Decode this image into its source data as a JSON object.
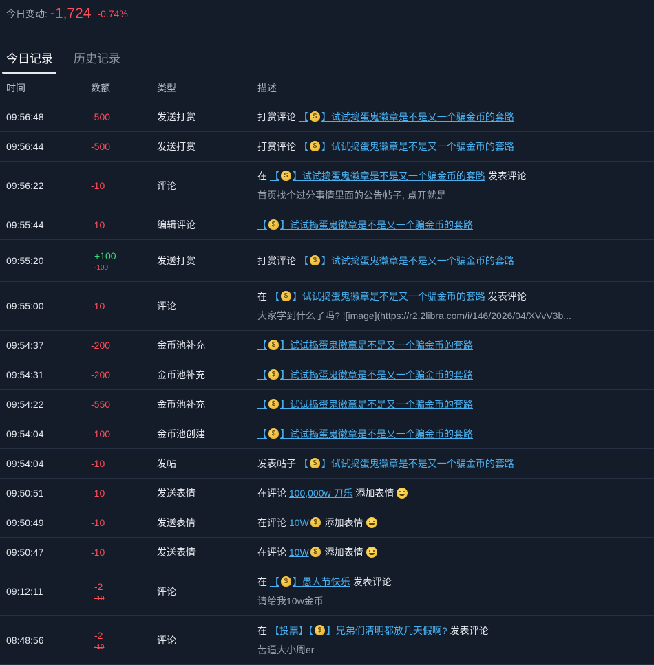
{
  "summary": {
    "label": "今日变动:",
    "value": "-1,724",
    "percent": "-0.74%"
  },
  "tabs": [
    {
      "label": "今日记录"
    },
    {
      "label": "历史记录"
    }
  ],
  "columns": {
    "time": "时间",
    "amount": "数额",
    "type": "类型",
    "desc": "描述"
  },
  "rows": [
    {
      "time": "09:56:48",
      "amount": "-500",
      "type": "发送打赏",
      "prefix": "打赏评论",
      "bracket_open": "【",
      "bracket_close": "】",
      "link": "试试捣蛋鬼徽章是不是又一个骗金币的套路"
    },
    {
      "time": "09:56:44",
      "amount": "-500",
      "type": "发送打赏",
      "prefix": "打赏评论",
      "bracket_open": "【",
      "bracket_close": "】",
      "link": "试试捣蛋鬼徽章是不是又一个骗金币的套路"
    },
    {
      "time": "09:56:22",
      "amount": "-10",
      "type": "评论",
      "prefix": "在",
      "bracket_open": "【",
      "bracket_close": "】",
      "link": "试试捣蛋鬼徽章是不是又一个骗金币的套路",
      "suffix": "发表评论",
      "sub": "首页找个过分事情里面的公告帖子, 点开就是"
    },
    {
      "time": "09:55:44",
      "amount": "-10",
      "type": "编辑评论",
      "bracket_open": "【",
      "bracket_close": "】",
      "link": "试试捣蛋鬼徽章是不是又一个骗金币的套路"
    },
    {
      "time": "09:55:20",
      "amount": "+100",
      "orig": "-100",
      "type": "发送打赏",
      "prefix": "打赏评论",
      "bracket_open": "【",
      "bracket_close": "】",
      "link": "试试捣蛋鬼徽章是不是又一个骗金币的套路"
    },
    {
      "time": "09:55:00",
      "amount": "-10",
      "type": "评论",
      "prefix": "在",
      "bracket_open": "【",
      "bracket_close": "】",
      "link": "试试捣蛋鬼徽章是不是又一个骗金币的套路",
      "suffix": "发表评论",
      "sub": "大家学到什么了吗? ![image](https://r2.2libra.com/i/146/2026/04/XVvV3b..."
    },
    {
      "time": "09:54:37",
      "amount": "-200",
      "type": "金币池补充",
      "bracket_open": "【",
      "bracket_close": "】",
      "link": "试试捣蛋鬼徽章是不是又一个骗金币的套路"
    },
    {
      "time": "09:54:31",
      "amount": "-200",
      "type": "金币池补充",
      "bracket_open": "【",
      "bracket_close": "】",
      "link": "试试捣蛋鬼徽章是不是又一个骗金币的套路"
    },
    {
      "time": "09:54:22",
      "amount": "-550",
      "type": "金币池补充",
      "bracket_open": "【",
      "bracket_close": "】",
      "link": "试试捣蛋鬼徽章是不是又一个骗金币的套路"
    },
    {
      "time": "09:54:04",
      "amount": "-100",
      "type": "金币池创建",
      "bracket_open": "【",
      "bracket_close": "】",
      "link": "试试捣蛋鬼徽章是不是又一个骗金币的套路"
    },
    {
      "time": "09:54:04",
      "amount": "-10",
      "type": "发帖",
      "prefix": "发表帖子",
      "bracket_open": "【",
      "bracket_close": "】",
      "link": "试试捣蛋鬼徽章是不是又一个骗金币的套路"
    },
    {
      "time": "09:50:51",
      "amount": "-10",
      "type": "发送表情",
      "prefix": "在评论",
      "link": "100,000w 刀乐",
      "suffix": "添加表情"
    },
    {
      "time": "09:50:49",
      "amount": "-10",
      "type": "发送表情",
      "prefix": "在评论",
      "link": "10W",
      "suffix": "添加表情"
    },
    {
      "time": "09:50:47",
      "amount": "-10",
      "type": "发送表情",
      "prefix": "在评论",
      "link": "10W",
      "suffix": "添加表情"
    },
    {
      "time": "09:12:11",
      "amount": "-2",
      "orig": "-10",
      "type": "评论",
      "prefix": "在",
      "bracket_open": "【",
      "bracket_close": "】",
      "link": "愚人节快乐",
      "suffix": "发表评论",
      "sub": "请给我10w金币"
    },
    {
      "time": "08:48:56",
      "amount": "-2",
      "orig": "-10",
      "type": "评论",
      "prefix": "在",
      "prelink": "【投票】【",
      "bracket_close": "】",
      "link": "兄弟们清明都放几天假啊?",
      "suffix": "发表评论",
      "sub": "苦逼大小周er"
    }
  ],
  "colors": {
    "negative": "#ff4d5a",
    "positive": "#3ddb7a",
    "link": "#4ab1f0",
    "bg": "#141c29"
  },
  "icons": {
    "money_bag": "money-bag-icon",
    "emoji": "smile-emoji-icon"
  }
}
